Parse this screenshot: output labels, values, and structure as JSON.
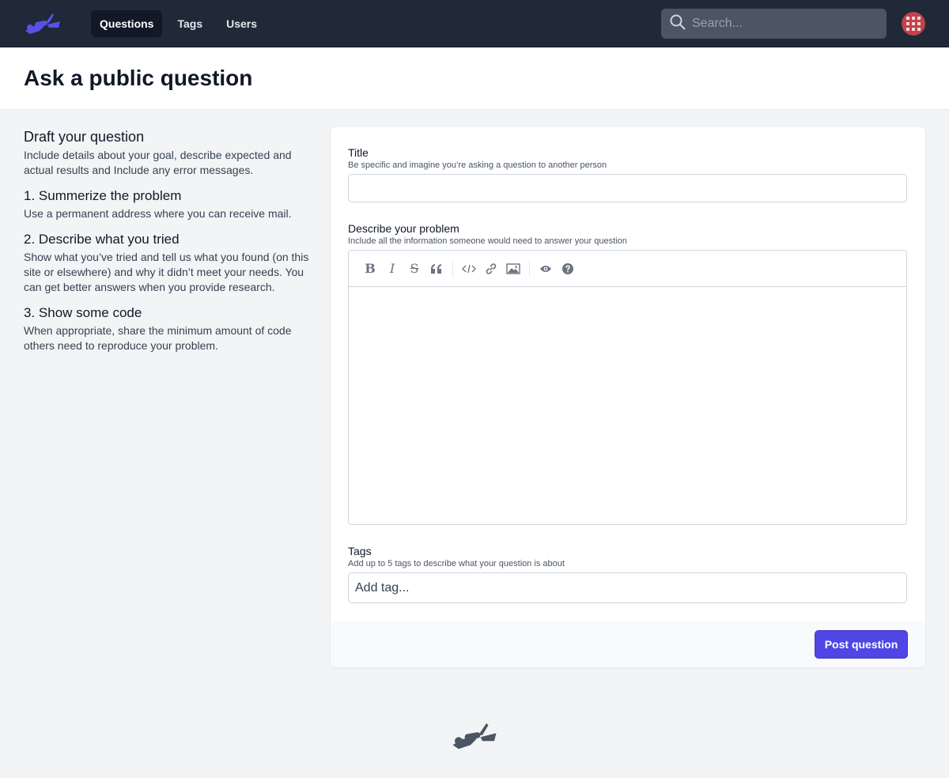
{
  "nav": {
    "links": [
      {
        "label": "Questions",
        "active": true
      },
      {
        "label": "Tags",
        "active": false
      },
      {
        "label": "Users",
        "active": false
      }
    ],
    "search_placeholder": "Search...",
    "logo_icon": "scuba-diver-icon"
  },
  "page": {
    "title": "Ask a public question"
  },
  "sidebar": {
    "sections": [
      {
        "heading": "Draft your question",
        "text": "Include details about your goal, describe expected and actual results and Include any error messages."
      },
      {
        "heading": "1. Summerize the problem",
        "text": "Use a permanent address where you can receive mail."
      },
      {
        "heading": "2. Describe what you tried",
        "text": "Show what you’ve tried and tell us what you found (on this site or elsewhere) and why it didn’t meet your needs. You can get better answers when you provide research."
      },
      {
        "heading": "3. Show some code",
        "text": "When appropriate, share the minimum amount of code others need to reproduce your problem."
      }
    ]
  },
  "form": {
    "title_label": "Title",
    "title_hint": "Be specific and imagine you’re asking a question to another person",
    "title_value": "",
    "body_label": "Describe your problem",
    "body_hint": "Include all the information someone would need to answer your question",
    "toolbar_icons": [
      "bold-icon",
      "italic-icon",
      "strikethrough-icon",
      "quote-icon",
      "code-icon",
      "link-icon",
      "image-icon",
      "preview-eye-icon",
      "help-icon"
    ],
    "tags_label": "Tags",
    "tags_hint": "Add up to 5 tags to describe what your question is about",
    "tags_placeholder": "Add tag...",
    "submit_label": "Post question"
  },
  "colors": {
    "navbar_bg": "#1f2937",
    "accent": "#4f46e5",
    "logo_purple": "#5b50e6",
    "footer_logo": "#4b5563"
  }
}
